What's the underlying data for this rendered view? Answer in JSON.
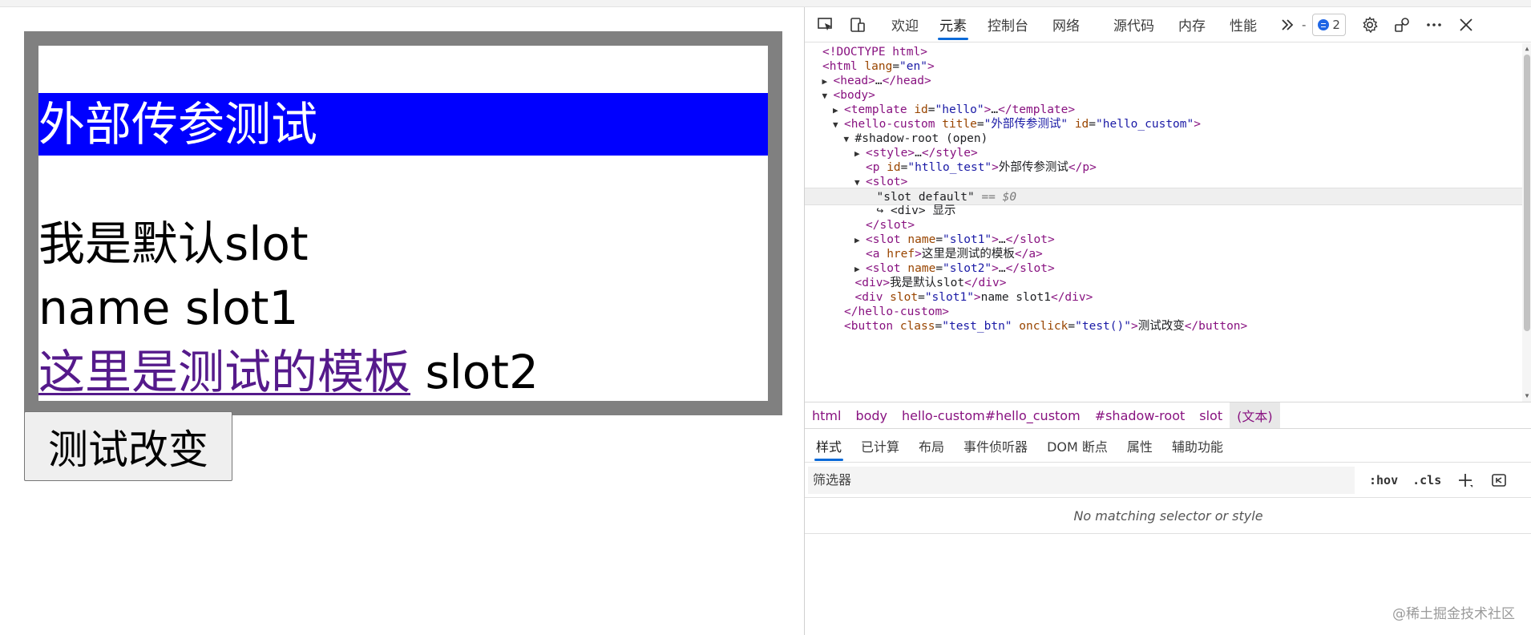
{
  "page": {
    "banner_text": "外部传参测试",
    "slot_default_text": "我是默认slot",
    "slot1_text": "name slot1",
    "template_link_text": "这里是测试的模板",
    "slot2_text": "slot2",
    "button_label": "测试改变"
  },
  "devtools": {
    "tabs": [
      "欢迎",
      "元素",
      "控制台",
      "网络",
      "源代码",
      "内存",
      "性能"
    ],
    "active_tab": "元素",
    "message_count": "2",
    "dom_lines": [
      {
        "indent": 0,
        "tri": "",
        "html": "<span class='tag'>&lt;!DOCTYPE html&gt;</span>"
      },
      {
        "indent": 0,
        "tri": "",
        "html": "<span class='tag'>&lt;html</span> <span class='attr-name'>lang</span>=<span class='attr-val'>\"en\"</span><span class='tag'>&gt;</span>"
      },
      {
        "indent": 1,
        "tri": "▶",
        "html": "<span class='tag'>&lt;head&gt;</span>…<span class='tag'>&lt;/head&gt;</span>"
      },
      {
        "indent": 1,
        "tri": "▼",
        "html": "<span class='tag'>&lt;body&gt;</span>"
      },
      {
        "indent": 2,
        "tri": "▶",
        "html": "<span class='tag'>&lt;template</span> <span class='attr-name'>id</span>=<span class='attr-val'>\"hello\"</span><span class='tag'>&gt;</span>…<span class='tag'>&lt;/template&gt;</span>"
      },
      {
        "indent": 2,
        "tri": "▼",
        "html": "<span class='tag'>&lt;hello-custom</span> <span class='attr-name'>title</span>=<span class='attr-val'>\"外部传参测试\"</span> <span class='attr-name'>id</span>=<span class='attr-val'>\"hello_custom\"</span><span class='tag'>&gt;</span>"
      },
      {
        "indent": 3,
        "tri": "▼",
        "html": "<span class='txt'>#shadow-root (open)</span>"
      },
      {
        "indent": 4,
        "tri": "▶",
        "html": "<span class='tag'>&lt;style&gt;</span>…<span class='tag'>&lt;/style&gt;</span>"
      },
      {
        "indent": 4,
        "tri": "",
        "html": "<span class='tag'>&lt;p</span> <span class='attr-name'>id</span>=<span class='attr-val'>\"htllo_test\"</span><span class='tag'>&gt;</span><span class='txt'>外部传参测试</span><span class='tag'>&lt;/p&gt;</span>"
      },
      {
        "indent": 4,
        "tri": "▼",
        "html": "<span class='tag'>&lt;slot&gt;</span>"
      },
      {
        "indent": 5,
        "tri": "",
        "html": "<span class='txt'>\"slot default\"</span> <span class='dim'>== $0</span>",
        "selected": true
      },
      {
        "indent": 5,
        "tri": "",
        "html": "<span class='txt'>↪ &lt;div&gt; 显示</span>"
      },
      {
        "indent": 4,
        "tri": "",
        "html": "<span class='tag'>&lt;/slot&gt;</span>"
      },
      {
        "indent": 4,
        "tri": "▶",
        "html": "<span class='tag'>&lt;slot</span> <span class='attr-name'>name</span>=<span class='attr-val'>\"slot1\"</span><span class='tag'>&gt;</span>…<span class='tag'>&lt;/slot&gt;</span>"
      },
      {
        "indent": 4,
        "tri": "",
        "html": "<span class='tag'>&lt;a</span> <span class='attr-name'>href</span><span class='tag'>&gt;</span><span class='txt'>这里是测试的模板</span><span class='tag'>&lt;/a&gt;</span>"
      },
      {
        "indent": 4,
        "tri": "▶",
        "html": "<span class='tag'>&lt;slot</span> <span class='attr-name'>name</span>=<span class='attr-val'>\"slot2\"</span><span class='tag'>&gt;</span>…<span class='tag'>&lt;/slot&gt;</span>"
      },
      {
        "indent": 3,
        "tri": "",
        "html": "<span class='tag'>&lt;div&gt;</span><span class='txt'>我是默认slot</span><span class='tag'>&lt;/div&gt;</span>"
      },
      {
        "indent": 3,
        "tri": "",
        "html": "<span class='tag'>&lt;div</span> <span class='attr-name'>slot</span>=<span class='attr-val'>\"slot1\"</span><span class='tag'>&gt;</span><span class='txt'>name slot1</span><span class='tag'>&lt;/div&gt;</span>"
      },
      {
        "indent": 2,
        "tri": "",
        "html": "<span class='tag'>&lt;/hello-custom&gt;</span>"
      },
      {
        "indent": 2,
        "tri": "",
        "html": "<span class='tag'>&lt;button</span> <span class='attr-name'>class</span>=<span class='attr-val'>\"test_btn\"</span> <span class='attr-name'>onclick</span>=<span class='attr-val'>\"test()\"</span><span class='tag'>&gt;</span><span class='txt'>测试改变</span><span class='tag'>&lt;/button&gt;</span>"
      }
    ],
    "breadcrumbs": [
      "html",
      "body",
      "hello-custom#hello_custom",
      "#shadow-root",
      "slot",
      "(文本)"
    ],
    "active_breadcrumb": "(文本)",
    "style_tabs": [
      "样式",
      "已计算",
      "布局",
      "事件侦听器",
      "DOM 断点",
      "属性",
      "辅助功能"
    ],
    "active_style_tab": "样式",
    "filter_placeholder": "筛选器",
    "hov_label": ":hov",
    "cls_label": ".cls",
    "no_match_text": "No matching selector or style",
    "watermark": "@稀土掘金技术社区"
  },
  "colors": {
    "frame_border": "#808080",
    "banner_bg": "#0000ff",
    "banner_text": "#ffffff",
    "link": "#551a8b",
    "accent": "#0b6ad8"
  },
  "icons": [
    "inspect-icon",
    "device-emulation-icon",
    "more-tabs-icon",
    "message-icon",
    "settings-icon",
    "connect-icon",
    "more-options-icon",
    "close-icon",
    "new-style-rule-icon",
    "toggle-sidebar-icon"
  ]
}
